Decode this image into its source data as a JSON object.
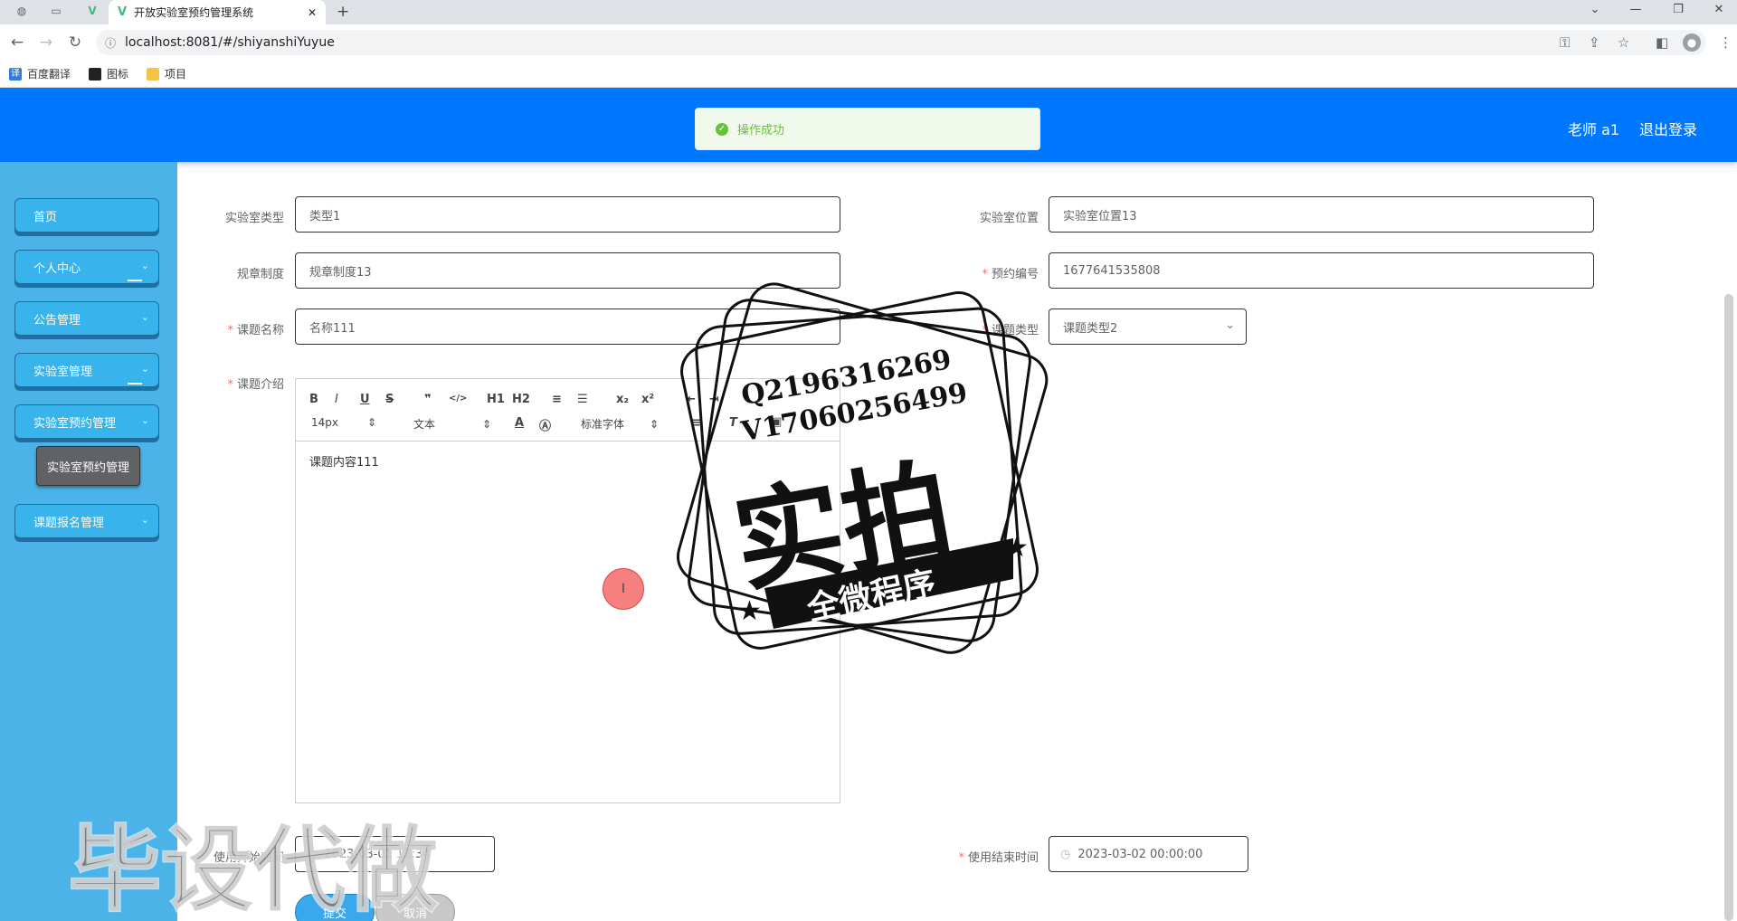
{
  "browser": {
    "tab_title": "开放实验室预约管理系统",
    "url": "localhost:8081/#/shiyanshiYuyue",
    "bookmarks": [
      {
        "label": "百度翻译",
        "icon": "translate-icon",
        "color": "#2a7de1"
      },
      {
        "label": "图标",
        "icon": "image-icon",
        "color": "#222222"
      },
      {
        "label": "项目",
        "icon": "folder-icon",
        "color": "#f4c542"
      }
    ]
  },
  "header": {
    "user": "老师 a1",
    "logout": "退出登录",
    "bg_color": "#0077ff"
  },
  "toast": {
    "message": "操作成功",
    "color": "#67c23a"
  },
  "sidebar": {
    "items": [
      {
        "label": "首页",
        "has_chevron": false
      },
      {
        "label": "个人中心",
        "has_chevron": true
      },
      {
        "label": "公告管理",
        "has_chevron": true
      },
      {
        "label": "实验室管理",
        "has_chevron": true
      },
      {
        "label": "实验室预约管理",
        "has_chevron": true
      },
      {
        "label": "课题报名管理",
        "has_chevron": true
      }
    ],
    "submenu_label": "实验室预约管理"
  },
  "form": {
    "lab_type": {
      "label": "实验室类型",
      "value": "类型1"
    },
    "lab_location": {
      "label": "实验室位置",
      "value": "实验室位置13"
    },
    "rules": {
      "label": "规章制度",
      "value": "规章制度13"
    },
    "booking_no": {
      "label": "预约编号",
      "value": "1677641535808",
      "required": true
    },
    "topic_name": {
      "label": "课题名称",
      "value": "名称111",
      "required": true
    },
    "topic_type": {
      "label": "课题类型",
      "value": "课题类型2",
      "required": true
    },
    "topic_intro": {
      "label": "课题介绍",
      "required": true,
      "content": "课题内容111"
    },
    "start_time": {
      "label": "使用开始时间",
      "value": "2023-03-01 12:34"
    },
    "end_time": {
      "label": "使用结束时间",
      "value": "2023-03-02 00:00:00",
      "required": true
    },
    "submit": "提交",
    "cancel": "取消"
  },
  "editor_toolbar": {
    "size": "14px",
    "header": "文本",
    "font": "标准字体",
    "buttons": [
      "B",
      "I",
      "U",
      "S",
      "❞",
      "</>",
      "H1",
      "H2",
      "≡",
      "☰",
      "x₂",
      "x²",
      "⇤",
      "⇥"
    ]
  },
  "watermarks": {
    "qq": "Q2196316269",
    "vx": "V17060256499",
    "stamp_big": "实拍",
    "stamp_banner": "全微程序",
    "bottom_left": "毕设代做"
  }
}
